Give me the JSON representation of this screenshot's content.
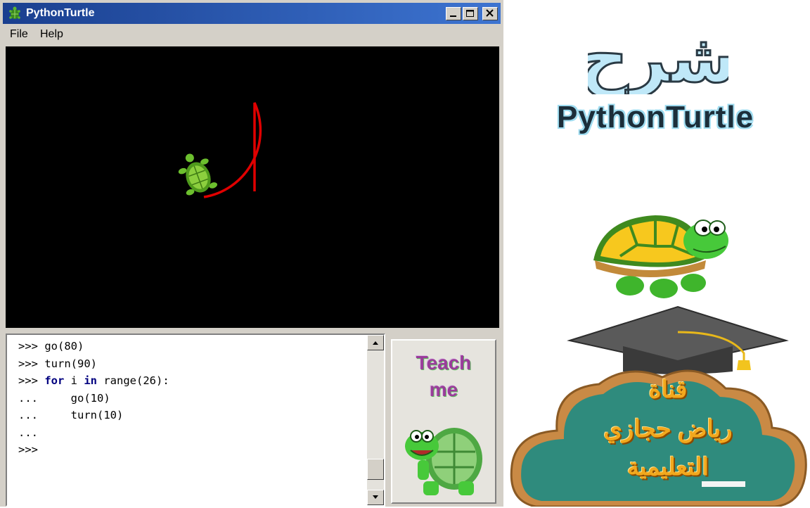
{
  "window": {
    "title": "PythonTurtle",
    "menu": [
      {
        "label": "File"
      },
      {
        "label": "Help"
      }
    ]
  },
  "colors": {
    "titlebar_start": "#1a3f8f",
    "titlebar_end": "#3d74d1",
    "pen": "#e00000",
    "canvas_bg": "#000000",
    "keyword": "#00007f",
    "teach_text": "#9a3c9a"
  },
  "icons": {
    "title": "turtle-icon",
    "minimize": "minimize-icon",
    "maximize": "maximize-icon",
    "close": "close-icon",
    "scroll_up": "arrow-up-icon",
    "scroll_down": "arrow-down-icon"
  },
  "shell": {
    "lines": [
      {
        "prompt": ">>> ",
        "keyword1": "",
        "mid": "go(80)",
        "keyword2": "",
        "tail": ""
      },
      {
        "prompt": ">>> ",
        "keyword1": "",
        "mid": "turn(90)",
        "keyword2": "",
        "tail": ""
      },
      {
        "prompt": ">>> ",
        "keyword1": "for",
        "mid": " i ",
        "keyword2": "in",
        "tail": " range(26):"
      },
      {
        "prompt": "...     ",
        "keyword1": "",
        "mid": "go(10)",
        "keyword2": "",
        "tail": ""
      },
      {
        "prompt": "...     ",
        "keyword1": "",
        "mid": "turn(10)",
        "keyword2": "",
        "tail": ""
      },
      {
        "prompt": "...",
        "keyword1": "",
        "mid": "",
        "keyword2": "",
        "tail": ""
      },
      {
        "prompt": ">>>",
        "keyword1": "",
        "mid": "",
        "keyword2": "",
        "tail": ""
      }
    ]
  },
  "teach": {
    "line1": "Teach",
    "line2": "me"
  },
  "promo": {
    "arabic_title": "شرح",
    "brand": "PythonTurtle",
    "channel": {
      "line1": "قناة",
      "line2": "رياض حجازي",
      "line3": "التعليمية"
    }
  }
}
